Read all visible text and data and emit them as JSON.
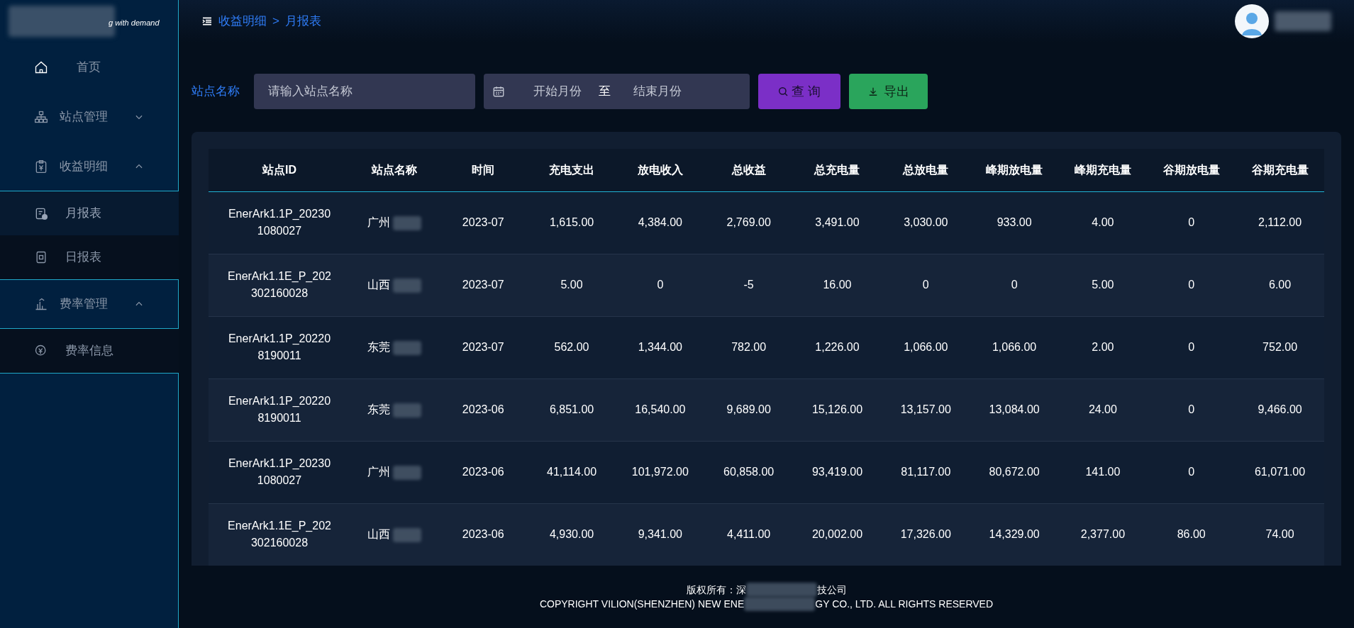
{
  "logo": {
    "tagline": "g with demand"
  },
  "sidebar": {
    "items": [
      {
        "label": "首页"
      },
      {
        "label": "站点管理",
        "expanded": false
      },
      {
        "label": "收益明细",
        "expanded": true,
        "children": [
          {
            "label": "月报表",
            "selected": true
          },
          {
            "label": "日报表",
            "selected": false
          }
        ]
      },
      {
        "label": "费率管理",
        "expanded": true,
        "children": [
          {
            "label": "费率信息",
            "selected": false
          }
        ]
      }
    ]
  },
  "breadcrumb": {
    "items": [
      "收益明细",
      "月报表"
    ],
    "separator": ">"
  },
  "filters": {
    "station_label": "站点名称",
    "station_placeholder": "请输入站点名称",
    "start_placeholder": "开始月份",
    "range_separator": "至",
    "end_placeholder": "结束月份",
    "query_button": "查 询",
    "export_button": "导出"
  },
  "table": {
    "columns": [
      "站点ID",
      "站点名称",
      "时间",
      "充电支出",
      "放电收入",
      "总收益",
      "总充电量",
      "总放电量",
      "峰期放电量",
      "峰期充电量",
      "谷期放电量",
      "谷期充电量"
    ],
    "rows": [
      [
        "EnerArk1.1P_202301080027",
        "广州",
        "2023-07",
        "1,615.00",
        "4,384.00",
        "2,769.00",
        "3,491.00",
        "3,030.00",
        "933.00",
        "4.00",
        "0",
        "2,112.00"
      ],
      [
        "EnerArk1.1E_P_202302160028",
        "山西",
        "2023-07",
        "5.00",
        "0",
        "-5",
        "16.00",
        "0",
        "0",
        "5.00",
        "0",
        "6.00"
      ],
      [
        "EnerArk1.1P_202208190011",
        "东莞",
        "2023-07",
        "562.00",
        "1,344.00",
        "782.00",
        "1,226.00",
        "1,066.00",
        "1,066.00",
        "2.00",
        "0",
        "752.00"
      ],
      [
        "EnerArk1.1P_202208190011",
        "东莞",
        "2023-06",
        "6,851.00",
        "16,540.00",
        "9,689.00",
        "15,126.00",
        "13,157.00",
        "13,084.00",
        "24.00",
        "0",
        "9,466.00"
      ],
      [
        "EnerArk1.1P_202301080027",
        "广州",
        "2023-06",
        "41,114.00",
        "101,972.00",
        "60,858.00",
        "93,419.00",
        "81,117.00",
        "80,672.00",
        "141.00",
        "0",
        "61,071.00"
      ],
      [
        "EnerArk1.1E_P_202302160028",
        "山西",
        "2023-06",
        "4,930.00",
        "9,341.00",
        "4,411.00",
        "20,002.00",
        "17,326.00",
        "14,329.00",
        "2,377.00",
        "86.00",
        "74.00"
      ]
    ]
  },
  "footer": {
    "line1_start": "版权所有：深",
    "line1_end": "技公司",
    "line2_start": "COPYRIGHT VILION(SHENZHEN) NEW ENE",
    "line2_end": "GY CO., LTD. ALL RIGHTS RESERVED"
  }
}
